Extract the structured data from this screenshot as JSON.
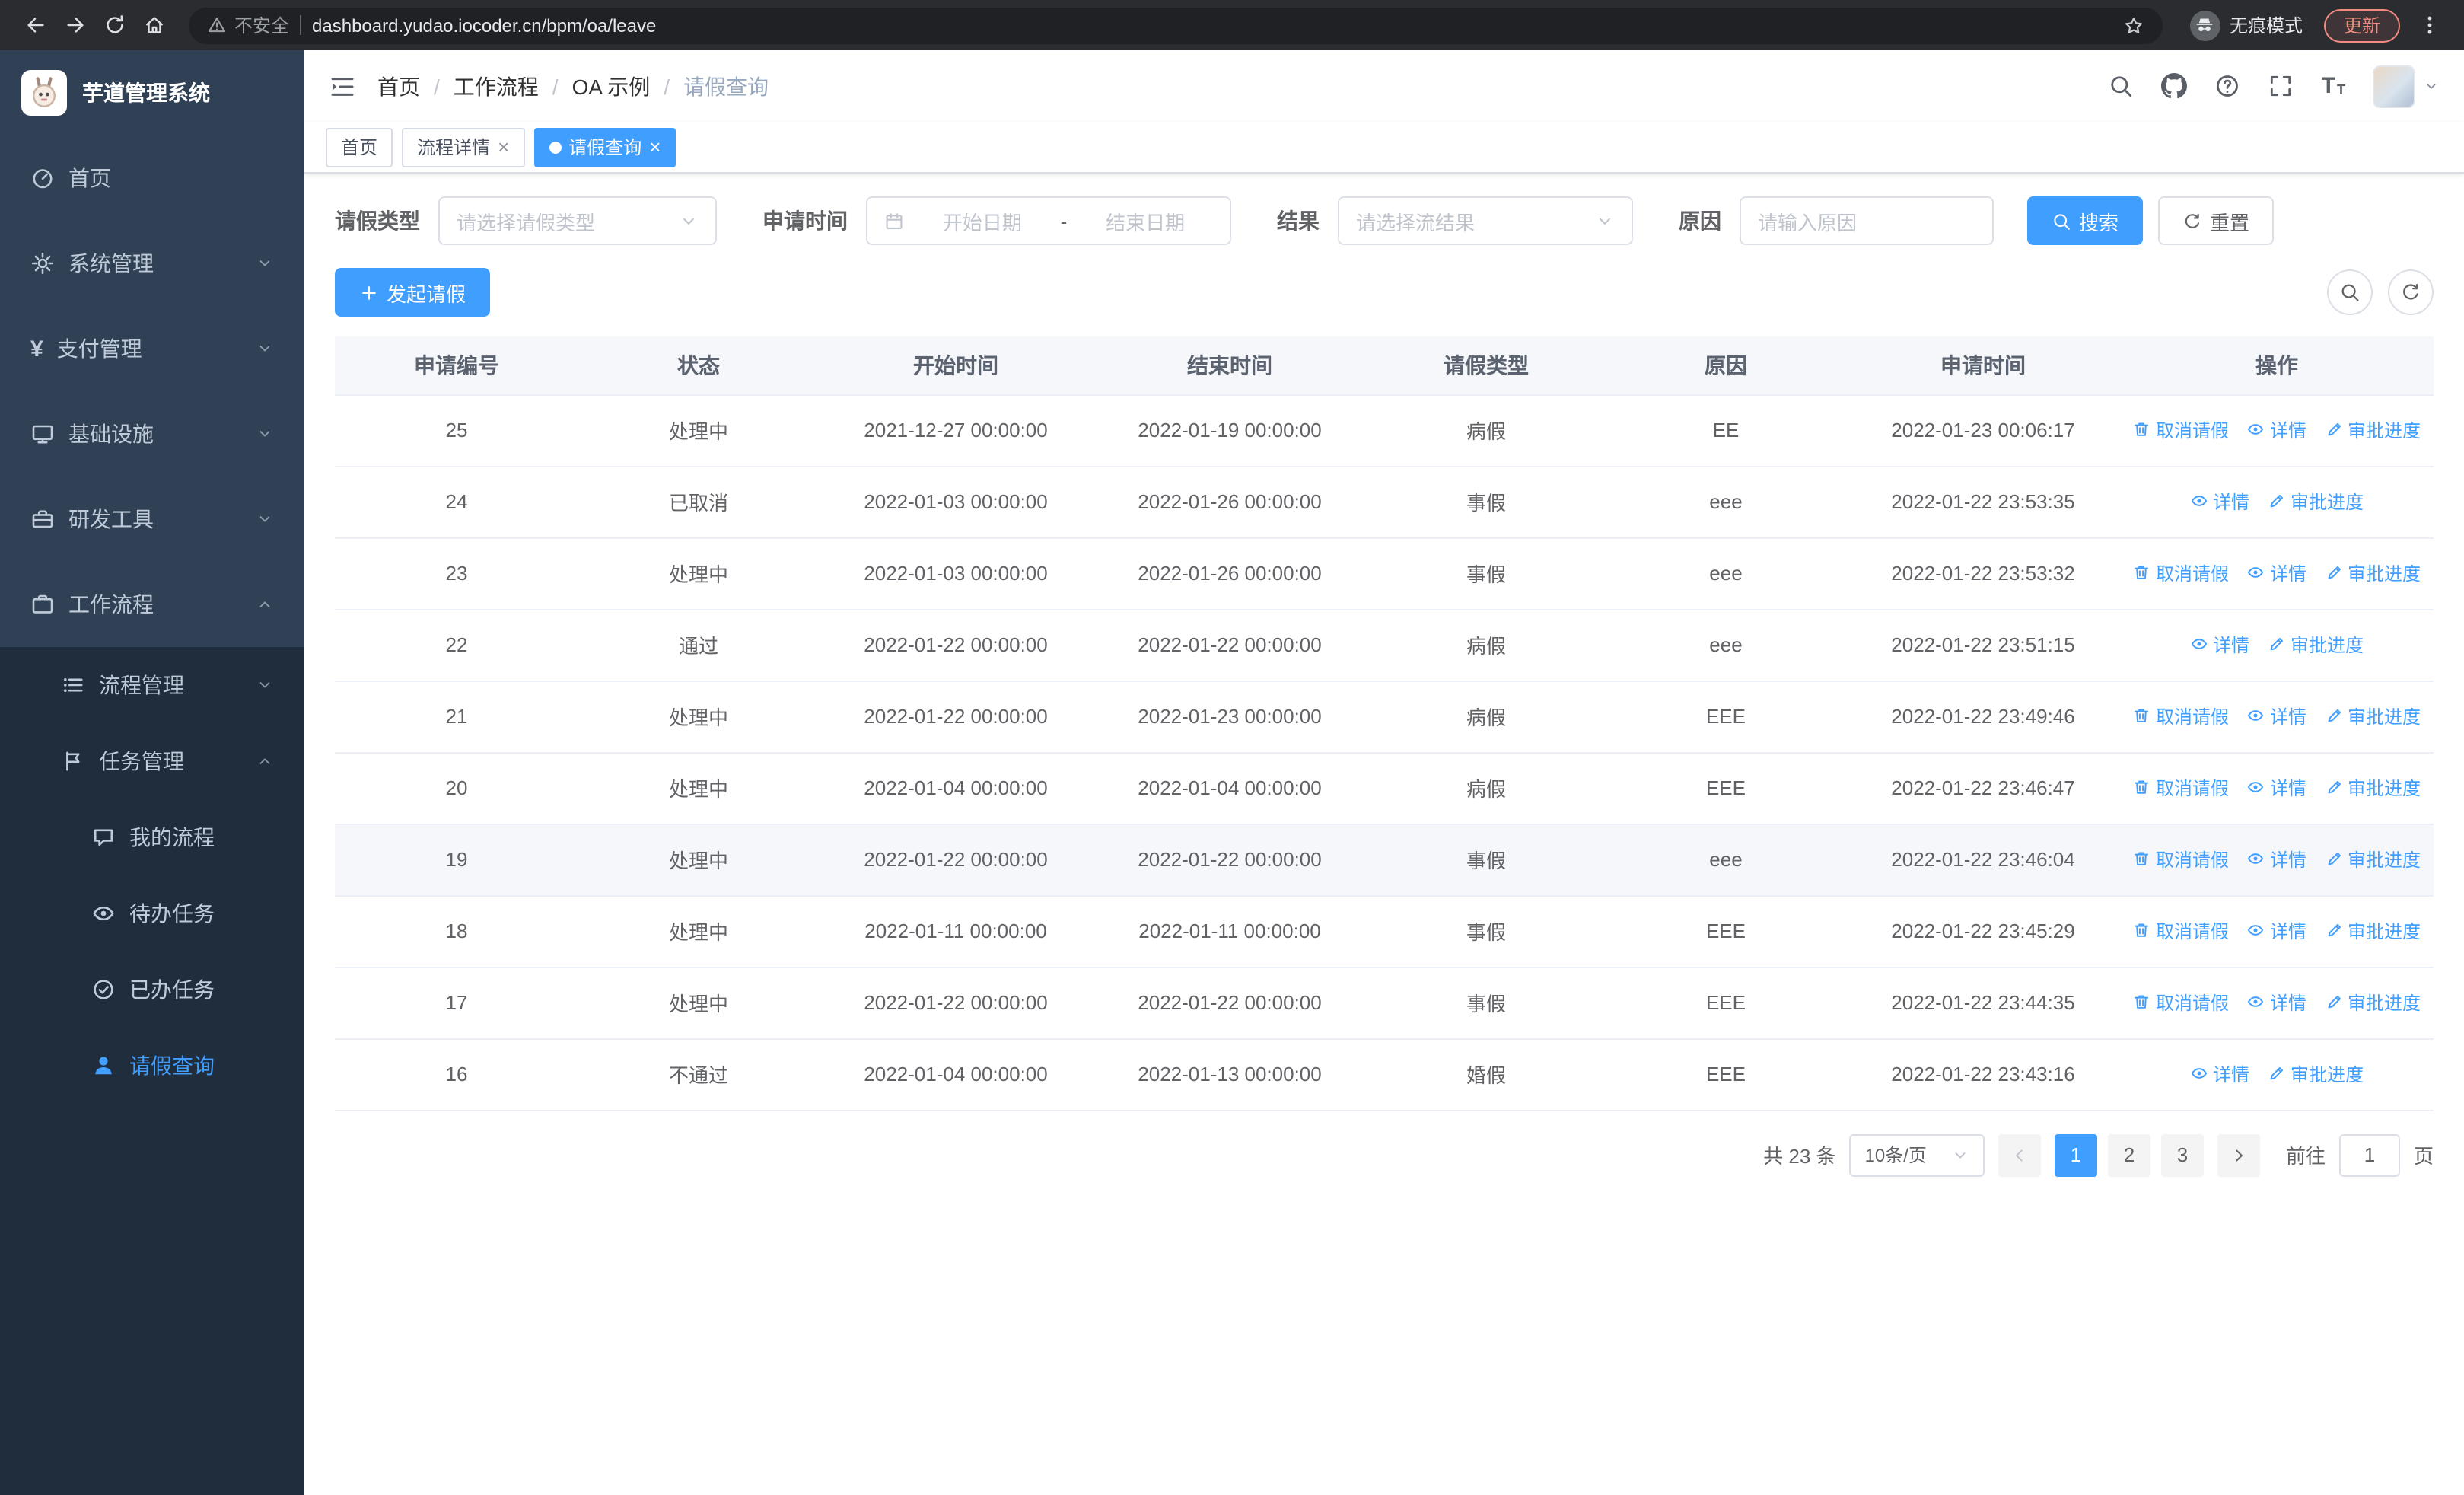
{
  "browser": {
    "security_warning": "不安全",
    "url": "dashboard.yudao.iocoder.cn/bpm/oa/leave",
    "incognito_label": "无痕模式",
    "update_button": "更新"
  },
  "sidebar": {
    "app_title": "芋道管理系统",
    "menu": [
      {
        "name": "home",
        "label": "首页",
        "icon": "dashboard-icon",
        "level": 0
      },
      {
        "name": "system",
        "label": "系统管理",
        "icon": "gear-icon",
        "level": 0,
        "arrow": "down"
      },
      {
        "name": "payment",
        "label": "支付管理",
        "icon": "yen-icon",
        "level": 0,
        "arrow": "down"
      },
      {
        "name": "infrastructure",
        "label": "基础设施",
        "icon": "monitor-icon",
        "level": 0,
        "arrow": "down"
      },
      {
        "name": "devtools",
        "label": "研发工具",
        "icon": "toolbox-icon",
        "level": 0,
        "arrow": "down"
      },
      {
        "name": "workflow",
        "label": "工作流程",
        "icon": "briefcase-icon",
        "level": 0,
        "arrow": "up"
      },
      {
        "name": "process-management",
        "label": "流程管理",
        "icon": "list-icon",
        "level": 1,
        "arrow": "down"
      },
      {
        "name": "task-management",
        "label": "任务管理",
        "icon": "flag-icon",
        "level": 1,
        "arrow": "up"
      },
      {
        "name": "my-process",
        "label": "我的流程",
        "icon": "chat-icon",
        "level": 2
      },
      {
        "name": "todo-tasks",
        "label": "待办任务",
        "icon": "eye-icon",
        "level": 2
      },
      {
        "name": "done-tasks",
        "label": "已办任务",
        "icon": "check-icon",
        "level": 2
      },
      {
        "name": "leave-query",
        "label": "请假查询",
        "icon": "user-icon",
        "level": 2,
        "active": true
      }
    ]
  },
  "header": {
    "breadcrumb": [
      "首页",
      "工作流程",
      "OA 示例",
      "请假查询"
    ]
  },
  "tabs": [
    {
      "name": "home",
      "label": "首页",
      "closable": false,
      "active": false
    },
    {
      "name": "process-detail",
      "label": "流程详情",
      "closable": true,
      "active": false
    },
    {
      "name": "leave-query",
      "label": "请假查询",
      "closable": true,
      "active": true
    }
  ],
  "filters": {
    "leave_type_label": "请假类型",
    "leave_type_placeholder": "请选择请假类型",
    "apply_time_label": "申请时间",
    "start_date_placeholder": "开始日期",
    "date_separator": "-",
    "end_date_placeholder": "结束日期",
    "result_label": "结果",
    "result_placeholder": "请选择流结果",
    "reason_label": "原因",
    "reason_placeholder": "请输入原因",
    "search_button": "搜索",
    "reset_button": "重置"
  },
  "toolbar": {
    "create_button": "发起请假"
  },
  "table": {
    "columns": [
      "申请编号",
      "状态",
      "开始时间",
      "结束时间",
      "请假类型",
      "原因",
      "申请时间",
      "操作"
    ],
    "action_labels": {
      "cancel": "取消请假",
      "detail": "详情",
      "progress": "审批进度"
    },
    "rows": [
      {
        "id": "25",
        "status": "处理中",
        "start": "2021-12-27 00:00:00",
        "end": "2022-01-19 00:00:00",
        "type": "病假",
        "reason": "EE",
        "apply_time": "2022-01-23 00:06:17",
        "actions": [
          "cancel",
          "detail",
          "progress"
        ]
      },
      {
        "id": "24",
        "status": "已取消",
        "start": "2022-01-03 00:00:00",
        "end": "2022-01-26 00:00:00",
        "type": "事假",
        "reason": "eee",
        "apply_time": "2022-01-22 23:53:35",
        "actions": [
          "detail",
          "progress"
        ]
      },
      {
        "id": "23",
        "status": "处理中",
        "start": "2022-01-03 00:00:00",
        "end": "2022-01-26 00:00:00",
        "type": "事假",
        "reason": "eee",
        "apply_time": "2022-01-22 23:53:32",
        "actions": [
          "cancel",
          "detail",
          "progress"
        ]
      },
      {
        "id": "22",
        "status": "通过",
        "start": "2022-01-22 00:00:00",
        "end": "2022-01-22 00:00:00",
        "type": "病假",
        "reason": "eee",
        "apply_time": "2022-01-22 23:51:15",
        "actions": [
          "detail",
          "progress"
        ]
      },
      {
        "id": "21",
        "status": "处理中",
        "start": "2022-01-22 00:00:00",
        "end": "2022-01-23 00:00:00",
        "type": "病假",
        "reason": "EEE",
        "apply_time": "2022-01-22 23:49:46",
        "actions": [
          "cancel",
          "detail",
          "progress"
        ]
      },
      {
        "id": "20",
        "status": "处理中",
        "start": "2022-01-04 00:00:00",
        "end": "2022-01-04 00:00:00",
        "type": "病假",
        "reason": "EEE",
        "apply_time": "2022-01-22 23:46:47",
        "actions": [
          "cancel",
          "detail",
          "progress"
        ]
      },
      {
        "id": "19",
        "status": "处理中",
        "start": "2022-01-22 00:00:00",
        "end": "2022-01-22 00:00:00",
        "type": "事假",
        "reason": "eee",
        "apply_time": "2022-01-22 23:46:04",
        "actions": [
          "cancel",
          "detail",
          "progress"
        ],
        "highlight": true
      },
      {
        "id": "18",
        "status": "处理中",
        "start": "2022-01-11 00:00:00",
        "end": "2022-01-11 00:00:00",
        "type": "事假",
        "reason": "EEE",
        "apply_time": "2022-01-22 23:45:29",
        "actions": [
          "cancel",
          "detail",
          "progress"
        ]
      },
      {
        "id": "17",
        "status": "处理中",
        "start": "2022-01-22 00:00:00",
        "end": "2022-01-22 00:00:00",
        "type": "事假",
        "reason": "EEE",
        "apply_time": "2022-01-22 23:44:35",
        "actions": [
          "cancel",
          "detail",
          "progress"
        ]
      },
      {
        "id": "16",
        "status": "不通过",
        "start": "2022-01-04 00:00:00",
        "end": "2022-01-13 00:00:00",
        "type": "婚假",
        "reason": "EEE",
        "apply_time": "2022-01-22 23:43:16",
        "actions": [
          "detail",
          "progress"
        ]
      }
    ]
  },
  "pagination": {
    "total_text": "共 23 条",
    "page_size": "10条/页",
    "pages": [
      "1",
      "2",
      "3"
    ],
    "active_page": "1",
    "goto_label": "前往",
    "goto_value": "1",
    "page_suffix": "页"
  },
  "colors": {
    "primary": "#409eff",
    "sidebar_bg": "#304156",
    "submenu_bg": "#1f2d3d",
    "table_header_bg": "#f5f7fa",
    "update_badge": "#f28b82"
  }
}
